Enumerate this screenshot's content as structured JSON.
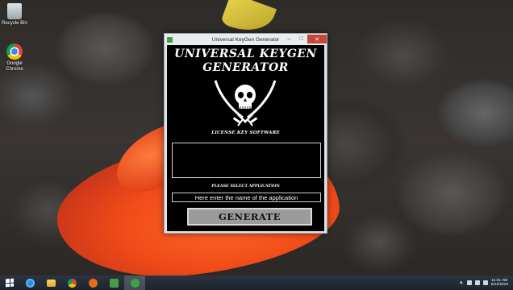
{
  "desktop": {
    "icons": [
      {
        "label": "Recycle Bin"
      },
      {
        "label": "Google Chrome"
      }
    ]
  },
  "window": {
    "title": "Universal KeyGen Generator",
    "controls": {
      "minimize": "–",
      "maximize": "□",
      "close": "✕"
    }
  },
  "app": {
    "heading_line1": "UNIVERSAL KEYGEN",
    "heading_line2": "GENERATOR",
    "logo_icon": "skull-crossed-swords-icon",
    "tagline": "LICENSE KEY SOFTWARE",
    "output_value": "",
    "select_label": "PLEASE SELECT APPLICATION",
    "app_name_value": "Here enter the name of the application",
    "generate_label": "GENERATE"
  },
  "taskbar": {
    "items": [
      {
        "name": "internet-explorer"
      },
      {
        "name": "file-explorer"
      },
      {
        "name": "google-chrome"
      },
      {
        "name": "media-player"
      },
      {
        "name": "camtasia"
      },
      {
        "name": "keygen-generator",
        "active": true
      }
    ],
    "clock": {
      "time": "11:21 AM",
      "date": "6/12/2016"
    }
  },
  "colors": {
    "app_background": "#000000",
    "button_background": "#9b9b9b",
    "close_button": "#c7463b",
    "taskbar": "#1d242c"
  }
}
